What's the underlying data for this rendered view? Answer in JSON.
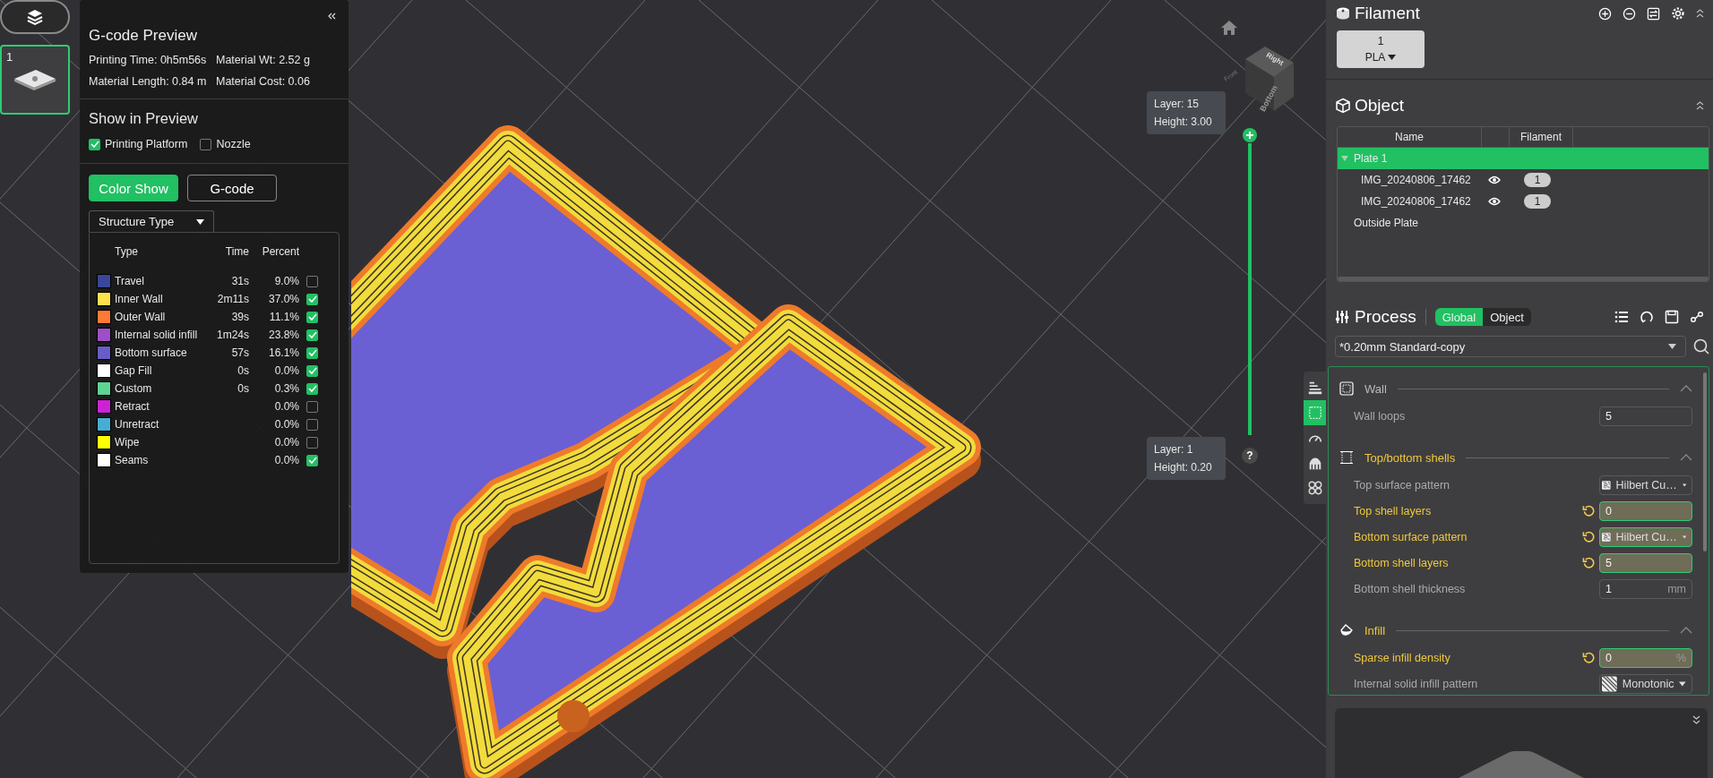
{
  "plates": [
    {
      "label": "1",
      "selected": true
    }
  ],
  "preview_panel": {
    "title": "G-code Preview",
    "stats": [
      "Printing Time: 0h5m56s",
      "Material Wt: 2.52 g",
      "Material Length: 0.84 m",
      "Material Cost: 0.06"
    ],
    "show_title": "Show in Preview",
    "options": [
      {
        "label": "Printing Platform",
        "checked": true
      },
      {
        "label": "Nozzle",
        "checked": false
      }
    ],
    "view_modes": [
      {
        "label": "Color Show",
        "selected": true
      },
      {
        "label": "G-code",
        "selected": false
      }
    ],
    "legend_dropdown": "Structure Type",
    "legend": {
      "columns": [
        "Type",
        "Time",
        "Percent"
      ],
      "rows": [
        {
          "type": "Travel",
          "time": "31s",
          "percent": "9.0%",
          "color": "#3a469a",
          "checked": false
        },
        {
          "type": "Inner Wall",
          "time": "2m11s",
          "percent": "37.0%",
          "color": "#ffe14d",
          "checked": true
        },
        {
          "type": "Outer Wall",
          "time": "39s",
          "percent": "11.1%",
          "color": "#ff7a33",
          "checked": true
        },
        {
          "type": "Internal solid infill",
          "time": "1m24s",
          "percent": "23.8%",
          "color": "#9e4fc8",
          "checked": true
        },
        {
          "type": "Bottom surface",
          "time": "57s",
          "percent": "16.1%",
          "color": "#6a5cc8",
          "checked": true
        },
        {
          "type": "Gap Fill",
          "time": "0s",
          "percent": "0.0%",
          "color": "#ffffff",
          "checked": true
        },
        {
          "type": "Custom",
          "time": "0s",
          "percent": "0.3%",
          "color": "#5ed394",
          "checked": true
        },
        {
          "type": "Retract",
          "percent": "0.0%",
          "color": "#cc22d6",
          "checked": false
        },
        {
          "type": "Unretract",
          "percent": "0.0%",
          "color": "#45aed2",
          "checked": false
        },
        {
          "type": "Wipe",
          "percent": "0.0%",
          "color": "#ffff00",
          "checked": false
        },
        {
          "type": "Seams",
          "percent": "0.0%",
          "color": "#ffffff",
          "checked": true
        }
      ]
    }
  },
  "view_cube": {
    "faces": [
      "Front",
      "Right",
      "Bottom"
    ]
  },
  "layer_slider": {
    "top": [
      "Layer: 15",
      "Height: 3.00"
    ],
    "bottom": [
      "Layer: 1",
      "Height: 0.20"
    ],
    "help": "?"
  },
  "view_toolbar": [
    {
      "kind": "layers",
      "selected": false
    },
    {
      "kind": "wall",
      "selected": true
    },
    {
      "kind": "speed",
      "selected": false
    },
    {
      "kind": "support",
      "selected": false
    },
    {
      "kind": "others",
      "selected": false
    }
  ],
  "filament": {
    "title": "Filament",
    "slots": [
      {
        "number": "1",
        "material": "PLA"
      }
    ]
  },
  "object": {
    "title": "Object",
    "columns": [
      "Name",
      "Filament"
    ],
    "tree": [
      {
        "name": "Plate 1",
        "selected": true,
        "expanded": true,
        "children": [
          {
            "name": "IMG_20240806_17462",
            "filament": "1"
          },
          {
            "name": "IMG_20240806_17462",
            "filament": "1"
          }
        ]
      },
      {
        "name": "Outside Plate",
        "selected": false
      }
    ]
  },
  "process": {
    "title": "Process",
    "scope_tabs": [
      {
        "label": "Global",
        "selected": true
      },
      {
        "label": "Object",
        "selected": false
      }
    ],
    "preset": "*0.20mm Standard-copy",
    "groups": [
      {
        "kind": "wall",
        "title": "Wall",
        "modified": false,
        "options": [
          {
            "kind": "input",
            "label": "Wall loops",
            "value": "5",
            "modified": false
          }
        ]
      },
      {
        "kind": "shells",
        "title": "Top/bottom shells",
        "modified": true,
        "options": [
          {
            "kind": "pattern",
            "label": "Top surface pattern",
            "value": "Hilbert Cu…",
            "modified": false
          },
          {
            "kind": "input",
            "label": "Top shell layers",
            "value": "0",
            "modified": true
          },
          {
            "kind": "pattern",
            "label": "Bottom surface pattern",
            "value": "Hilbert Cu…",
            "modified": true
          },
          {
            "kind": "input",
            "label": "Bottom shell layers",
            "value": "5",
            "modified": true
          },
          {
            "kind": "input",
            "label": "Bottom shell thickness",
            "value": "1",
            "unit": "mm",
            "modified": false
          }
        ]
      },
      {
        "kind": "infill",
        "title": "Infill",
        "modified": true,
        "options": [
          {
            "kind": "input",
            "label": "Sparse infill density",
            "value": "0",
            "unit": "%",
            "modified": true
          },
          {
            "kind": "pattern",
            "label": "Internal solid infill pattern",
            "value": "Monotonic",
            "modified": false
          }
        ]
      }
    ]
  }
}
